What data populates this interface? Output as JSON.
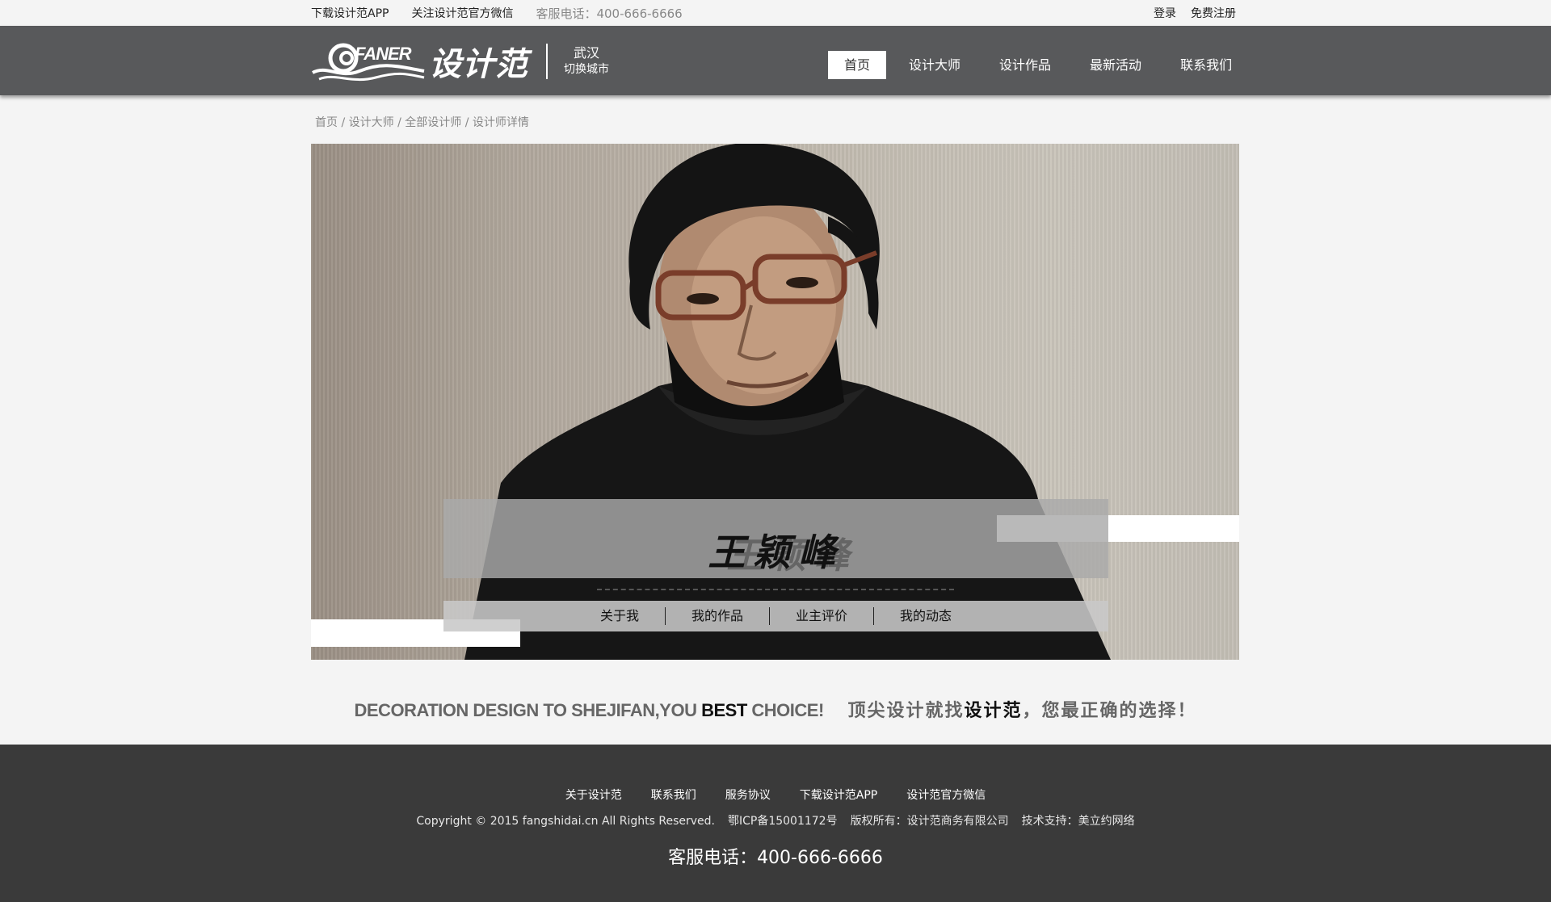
{
  "topbar": {
    "download_app": "下载设计范APP",
    "follow_wechat": "关注设计范官方微信",
    "phone": "客服电话：400-666-6666",
    "login": "登录",
    "register": "免费注册"
  },
  "header": {
    "logo_en": "FANER",
    "logo_cn": "设计范",
    "city": "武汉",
    "switch_city": "切换城市",
    "nav": [
      "首页",
      "设计大师",
      "设计作品",
      "最新活动",
      "联系我们"
    ],
    "active_nav": "首页"
  },
  "breadcrumb": [
    "首页",
    "设计大师",
    "全部设计师",
    "设计师详情"
  ],
  "breadcrumb_sep": " / ",
  "designer": {
    "name": "王颖峰",
    "tabs": [
      "关于我",
      "我的作品",
      "业主评价",
      "我的动态"
    ]
  },
  "slogan": {
    "en_part1": "DECORATION DESIGN TO SHEJIFAN,YOU ",
    "en_bold": "BEST",
    "en_part2": " CHOICE!",
    "cn_part1": "顶尖设计就找",
    "cn_bold": "设计范",
    "cn_part2": "，您最正确的选择！"
  },
  "footer": {
    "links": [
      "关于设计范",
      "联系我们",
      "服务协议",
      "下载设计范APP",
      "设计范官方微信"
    ],
    "copyright": "Copyright © 2015 fangshidai.cn All Rights Reserved.",
    "icp": "鄂ICP备15001172号",
    "owner": "版权所有：设计范商务有限公司",
    "support": "技术支持：美立约网络",
    "hotline": "客服电话：400-666-6666"
  },
  "colors": {
    "header_bg": "#58595b",
    "footer_bg": "#3a3a3a",
    "page_bg": "#f4f4f4"
  }
}
